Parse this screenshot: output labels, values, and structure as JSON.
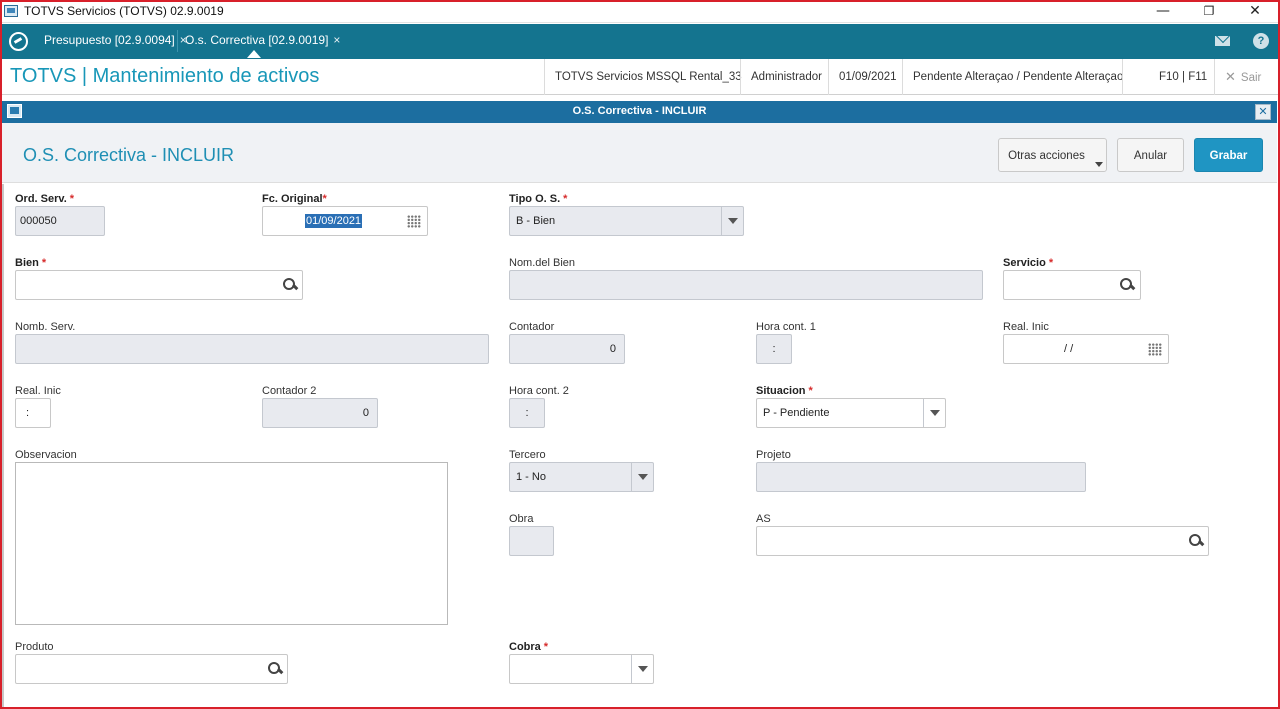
{
  "window": {
    "title": "TOTVS Servicios (TOTVS) 02.9.0019",
    "min_glyph": "—",
    "max_glyph": "❐",
    "close_glyph": "✕"
  },
  "tabs": [
    {
      "label": "Presupuesto [02.9.0094]",
      "close": "×"
    },
    {
      "label": "O.s. Correctiva [02.9.0019]",
      "close": "×"
    }
  ],
  "header": {
    "app_title": "TOTVS | Mantenimiento de activos",
    "environment": "TOTVS Servicios MSSQL Rental_33",
    "user": "Administrador",
    "date": "01/09/2021",
    "status": "Pendente Alteraçao / Pendente Alteraçao",
    "shortcuts": "F10 | F11",
    "exit_label": "Sair",
    "exit_glyph": "✕"
  },
  "dialog": {
    "bar_title": "O.S. Correctiva - INCLUIR",
    "close_glyph": "✕",
    "form_title": "O.S. Correctiva - INCLUIR",
    "buttons": {
      "otras": "Otras acciones",
      "anular": "Anular",
      "grabar": "Grabar"
    }
  },
  "required_mark": "*",
  "fields": {
    "ord_serv": {
      "label": "Ord. Serv.",
      "value": "000050"
    },
    "fc_original": {
      "label": "Fc. Original",
      "value": "01/09/2021"
    },
    "tipo_os": {
      "label": "Tipo O. S.",
      "value": "B - Bien"
    },
    "bien": {
      "label": "Bien",
      "value": ""
    },
    "nom_bien": {
      "label": "Nom.del Bien",
      "value": ""
    },
    "servicio": {
      "label": "Servicio",
      "value": ""
    },
    "nomb_serv": {
      "label": "Nomb. Serv.",
      "value": ""
    },
    "contador": {
      "label": "Contador",
      "value": "0"
    },
    "hora_cont1": {
      "label": "Hora cont. 1",
      "value": ":"
    },
    "real_inic_date": {
      "label": "Real. Inic",
      "value": "/ /"
    },
    "real_inic_time": {
      "label": "Real. Inic",
      "value": ":"
    },
    "contador2": {
      "label": "Contador 2",
      "value": "0"
    },
    "hora_cont2": {
      "label": "Hora cont. 2",
      "value": ":"
    },
    "situacion": {
      "label": "Situacion",
      "value": "P - Pendiente"
    },
    "observacion": {
      "label": "Observacion",
      "value": ""
    },
    "tercero": {
      "label": "Tercero",
      "value": "1 - No"
    },
    "projeto": {
      "label": "Projeto",
      "value": ""
    },
    "obra": {
      "label": "Obra",
      "value": ""
    },
    "as": {
      "label": "AS",
      "value": ""
    },
    "produto": {
      "label": "Produto",
      "value": ""
    },
    "cobra": {
      "label": "Cobra",
      "value": ""
    }
  }
}
